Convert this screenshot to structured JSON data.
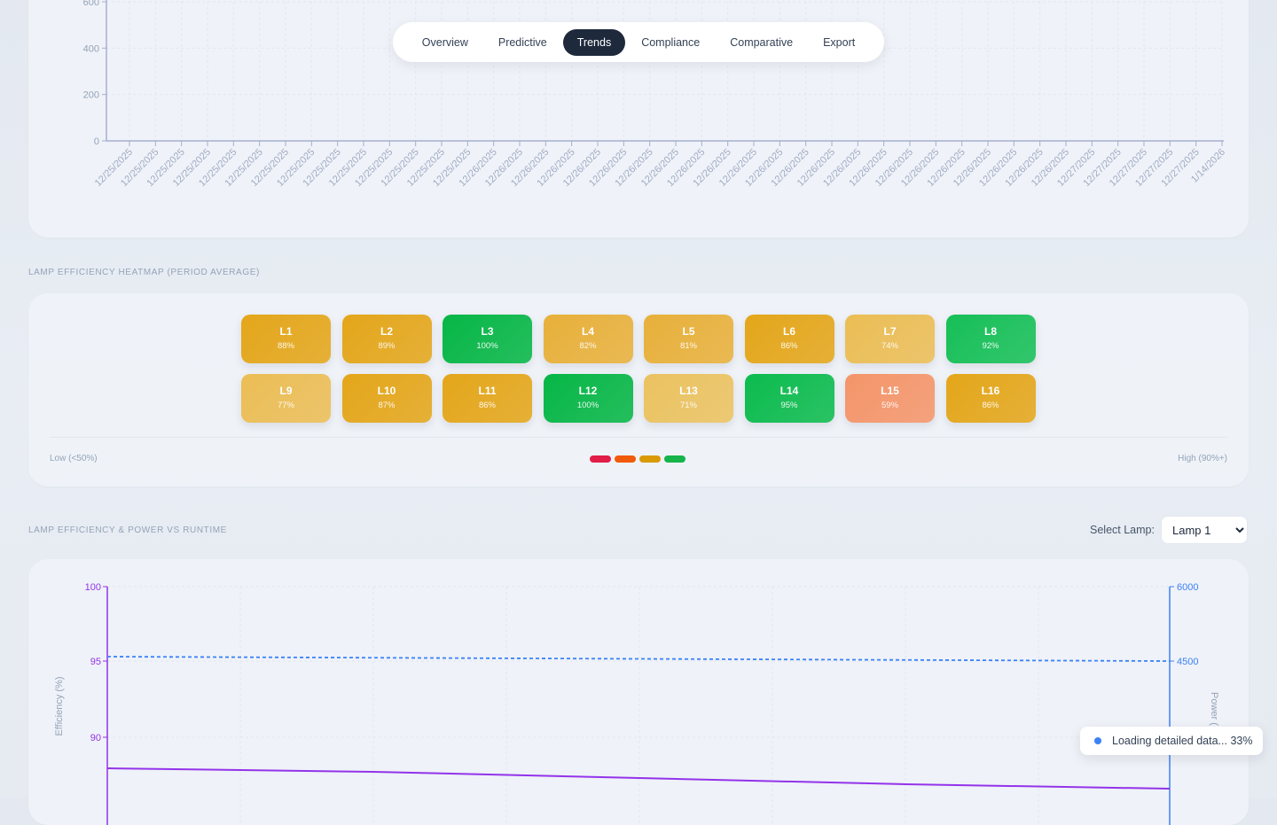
{
  "nav": {
    "tabs": [
      {
        "label": "Overview"
      },
      {
        "label": "Predictive"
      },
      {
        "label": "Trends"
      },
      {
        "label": "Compliance"
      },
      {
        "label": "Comparative"
      },
      {
        "label": "Export"
      }
    ],
    "active": "Trends"
  },
  "trend_chart": {
    "y_ticks": [
      "0",
      "200",
      "400",
      "600"
    ],
    "x_labels": [
      "12/25/2025",
      "12/25/2025",
      "12/25/2025",
      "12/25/2025",
      "12/25/2025",
      "12/25/2025",
      "12/25/2025",
      "12/25/2025",
      "12/25/2025",
      "12/25/2025",
      "12/25/2025",
      "12/25/2025",
      "12/25/2025",
      "12/25/2025",
      "12/26/2025",
      "12/26/2025",
      "12/26/2025",
      "12/26/2025",
      "12/26/2025",
      "12/26/2025",
      "12/26/2025",
      "12/26/2025",
      "12/26/2025",
      "12/26/2025",
      "12/26/2025",
      "12/26/2025",
      "12/26/2025",
      "12/26/2025",
      "12/26/2025",
      "12/26/2025",
      "12/26/2025",
      "12/26/2025",
      "12/26/2025",
      "12/26/2025",
      "12/26/2025",
      "12/26/2025",
      "12/26/2025",
      "12/27/2025",
      "12/27/2025",
      "12/27/2025",
      "12/27/2025",
      "12/27/2025",
      "1/14/2026"
    ]
  },
  "heatmap": {
    "section_label": "Lamp Efficiency Heatmap (Period Average)",
    "tiles": [
      {
        "name": "L1",
        "value": "88%",
        "color": "#e4a61a"
      },
      {
        "name": "L2",
        "value": "89%",
        "color": "#e4a61a"
      },
      {
        "name": "L3",
        "value": "100%",
        "color": "#06b646"
      },
      {
        "name": "L4",
        "value": "82%",
        "color": "#e8b03a"
      },
      {
        "name": "L5",
        "value": "81%",
        "color": "#e8b03a"
      },
      {
        "name": "L6",
        "value": "86%",
        "color": "#e4a61a"
      },
      {
        "name": "L7",
        "value": "74%",
        "color": "#ebbd55"
      },
      {
        "name": "L8",
        "value": "92%",
        "color": "#16bf57"
      },
      {
        "name": "L9",
        "value": "77%",
        "color": "#ebbd55"
      },
      {
        "name": "L10",
        "value": "87%",
        "color": "#e4a61a"
      },
      {
        "name": "L11",
        "value": "86%",
        "color": "#e4a61a"
      },
      {
        "name": "L12",
        "value": "100%",
        "color": "#06b646"
      },
      {
        "name": "L13",
        "value": "71%",
        "color": "#ebc260"
      },
      {
        "name": "L14",
        "value": "95%",
        "color": "#0cbb4e"
      },
      {
        "name": "L15",
        "value": "59%",
        "color": "#f4956a"
      },
      {
        "name": "L16",
        "value": "86%",
        "color": "#e4a61a"
      }
    ],
    "legend_low": "Low (<50%)",
    "legend_high": "High (90%+)",
    "legend_colors": [
      "#e11d48",
      "#f05a0a",
      "#d99a06",
      "#16b44a"
    ]
  },
  "runtime": {
    "section_label": "Lamp Efficiency & Power vs Runtime",
    "select_label": "Select Lamp:",
    "select_value": "Lamp 1",
    "y_left_label": "Efficiency (%)",
    "y_left_ticks": [
      "90",
      "95",
      "100"
    ],
    "y_right_label": "Power (",
    "y_right_ticks": [
      "4500",
      "6000"
    ],
    "colors": {
      "efficiency": "#9333ea",
      "power": "#3b82f6"
    }
  },
  "toast": {
    "text": "Loading detailed data... 33%"
  }
}
